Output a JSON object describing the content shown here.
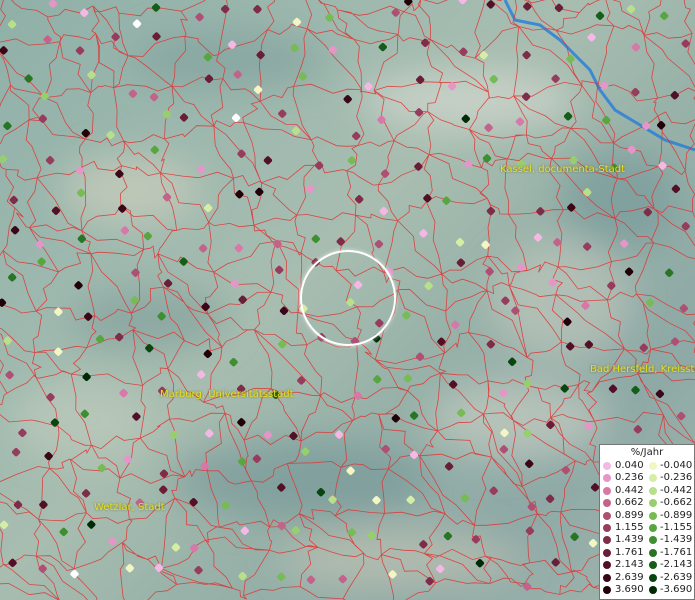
{
  "places": [
    {
      "label": "Kassel, documenta-Stadt"
    },
    {
      "label": "Marburg, Universitätsstadt"
    },
    {
      "label": "Bad Hersfeld, Kreisstadt"
    },
    {
      "label": "Wetzlar, Stadt"
    }
  ],
  "legend": {
    "title": "%/Jahr",
    "positive": [
      {
        "value": "0.040",
        "color": "#f4b8e4"
      },
      {
        "value": "0.236",
        "color": "#e695c8"
      },
      {
        "value": "0.442",
        "color": "#d778a9"
      },
      {
        "value": "0.662",
        "color": "#c3638c"
      },
      {
        "value": "0.899",
        "color": "#ad5074"
      },
      {
        "value": "1.155",
        "color": "#963d5e"
      },
      {
        "value": "1.439",
        "color": "#7f2c49"
      },
      {
        "value": "1.761",
        "color": "#691d36"
      },
      {
        "value": "2.143",
        "color": "#521026"
      },
      {
        "value": "2.639",
        "color": "#3a0718"
      },
      {
        "value": "3.690",
        "color": "#220008"
      }
    ],
    "negative": [
      {
        "value": "-0.040",
        "color": "#f2f5c4"
      },
      {
        "value": "-0.236",
        "color": "#d6eea4"
      },
      {
        "value": "-0.442",
        "color": "#b8e08a"
      },
      {
        "value": "-0.662",
        "color": "#98cf6e"
      },
      {
        "value": "-0.899",
        "color": "#76bb54"
      },
      {
        "value": "-1.155",
        "color": "#58a640"
      },
      {
        "value": "-1.439",
        "color": "#3e8f30"
      },
      {
        "value": "-1.761",
        "color": "#287624"
      },
      {
        "value": "-2.143",
        "color": "#155e18"
      },
      {
        "value": "-2.639",
        "color": "#08460f"
      },
      {
        "value": "-3.690",
        "color": "#002a06"
      }
    ]
  },
  "colors": {
    "borders": "#e03030",
    "river": "#2a80d8",
    "label": "#e8e020",
    "focus_ring": "#ffffff"
  }
}
